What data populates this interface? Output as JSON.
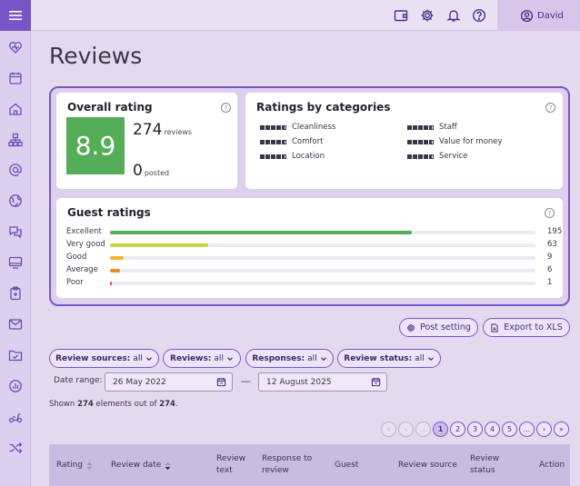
{
  "user": {
    "name": "David"
  },
  "page": {
    "title": "Reviews"
  },
  "overall": {
    "title": "Overall rating",
    "score": "8.9",
    "reviews_count": "274",
    "reviews_label": "reviews",
    "posted_count": "0",
    "posted_label": "posted",
    "help": "?"
  },
  "categories": {
    "title": "Ratings by categories",
    "help": "?",
    "items": [
      {
        "label": "Cleanliness"
      },
      {
        "label": "Comfort"
      },
      {
        "label": "Location"
      },
      {
        "label": "Staff"
      },
      {
        "label": "Value for money"
      },
      {
        "label": "Service"
      }
    ]
  },
  "guest": {
    "title": "Guest ratings",
    "help": "?",
    "rows": [
      {
        "label": "Excellent",
        "count": "195",
        "fraction": 0.71,
        "color": "#55ad57"
      },
      {
        "label": "Very good",
        "count": "63",
        "fraction": 0.23,
        "color": "#c9d34b"
      },
      {
        "label": "Good",
        "count": "9",
        "fraction": 0.033,
        "color": "#f5b324"
      },
      {
        "label": "Average",
        "count": "6",
        "fraction": 0.024,
        "color": "#f0882b"
      },
      {
        "label": "Poor",
        "count": "1",
        "fraction": 0.004,
        "color": "#e24b3b"
      }
    ]
  },
  "actions": {
    "post_setting": "Post setting",
    "export": "Export to XLS"
  },
  "filters": [
    {
      "name": "Review sources:",
      "value": "all"
    },
    {
      "name": "Reviews:",
      "value": "all"
    },
    {
      "name": "Responses:",
      "value": "all"
    },
    {
      "name": "Review status:",
      "value": "all"
    }
  ],
  "date_range": {
    "label": "Date range:",
    "from": "26 May 2022",
    "to": "12 August 2025",
    "separator": "—"
  },
  "shown": {
    "prefix": "Shown",
    "count": "274",
    "middle": "elements out of",
    "total": "274",
    "suffix": "."
  },
  "pagination": {
    "first": "«",
    "prev": "‹",
    "ellipsis_left": "...",
    "pages": [
      "1",
      "2",
      "3",
      "4",
      "5"
    ],
    "ellipsis_right": "...",
    "next": "›",
    "last": "»"
  },
  "table_headers": {
    "rating": "Rating",
    "review_date": "Review date",
    "review_text_1": "Review",
    "review_text_2": "text",
    "response_1": "Response to",
    "response_2": "review",
    "guest": "Guest",
    "review_source": "Review source",
    "review_status_1": "Review",
    "review_status_2": "status",
    "action": "Action"
  },
  "colors": {
    "accent": "#7a55c8",
    "score_bg": "#55ad57"
  },
  "icons": [
    "menu-icon",
    "heart-pulse-icon",
    "calendar-icon",
    "home-icon",
    "sitemap-icon",
    "at-sign-icon",
    "globe-icon",
    "chat-icon",
    "monitor-icon",
    "clipboard-icon",
    "mail-icon",
    "folder-check-icon",
    "bar-chart-icon",
    "scooter-icon",
    "shuffle-icon",
    "wallet-icon",
    "gear-icon",
    "bell-icon",
    "help-icon",
    "user-circle-icon",
    "calendar-input-icon",
    "sort-icon"
  ]
}
